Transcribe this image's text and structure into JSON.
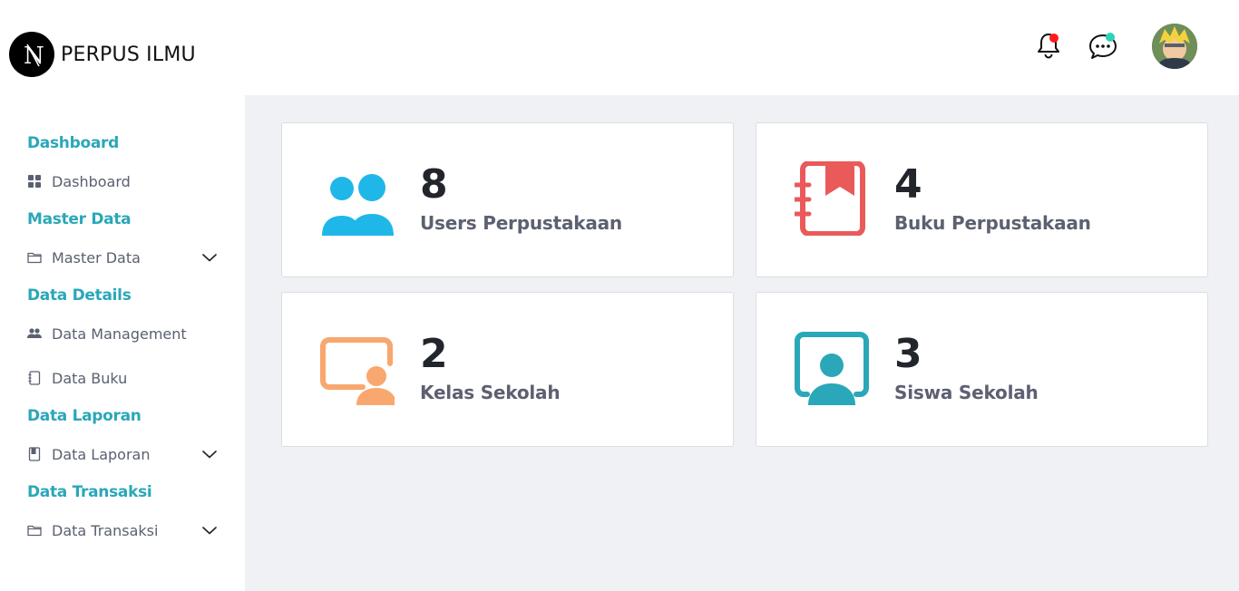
{
  "app": {
    "title": "PERPUS ILMU",
    "logo_letter": "N"
  },
  "header": {
    "notification_icon": "bell-icon",
    "notification_badge_color": "#ff1a1a",
    "message_icon": "chat-icon",
    "message_badge_color": "#2ed3b7",
    "avatar": "user-avatar"
  },
  "sidebar": {
    "accent_color": "#2aa7b8",
    "sections": [
      {
        "title": "Dashboard"
      },
      {
        "title": "Master Data"
      },
      {
        "title": "Data Details"
      },
      {
        "title": "Data Laporan"
      },
      {
        "title": "Data Transaksi"
      }
    ],
    "items": [
      {
        "label": "Dashboard",
        "icon": "grid-icon",
        "has_submenu": false
      },
      {
        "label": "Master Data",
        "icon": "folder-icon",
        "has_submenu": true
      },
      {
        "label": "Data Management",
        "icon": "users-icon",
        "has_submenu": false
      },
      {
        "label": "Data Buku",
        "icon": "notebook-icon",
        "has_submenu": false
      },
      {
        "label": "Data Laporan",
        "icon": "book-icon",
        "has_submenu": true
      },
      {
        "label": "Data Transaksi",
        "icon": "folder-icon",
        "has_submenu": true
      }
    ]
  },
  "cards": [
    {
      "value": "8",
      "label": "Users Perpustakaan",
      "icon": "users-icon",
      "color": "#1fb7e8"
    },
    {
      "value": "4",
      "label": "Buku Perpustakaan",
      "icon": "notebook-icon",
      "color": "#ea5a5a"
    },
    {
      "value": "2",
      "label": "Kelas Sekolah",
      "icon": "presentation-icon",
      "color": "#f8a76e"
    },
    {
      "value": "3",
      "label": "Siswa Sekolah",
      "icon": "student-screen-icon",
      "color": "#2aa7b8"
    }
  ]
}
